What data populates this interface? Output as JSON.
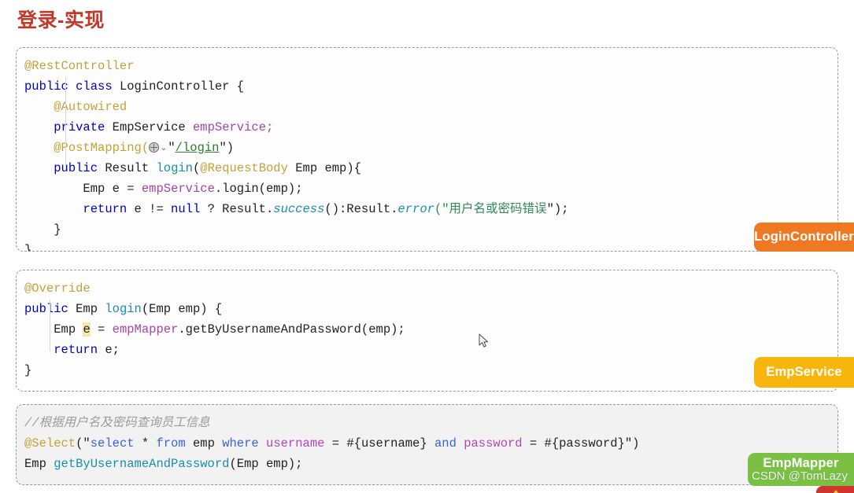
{
  "page": {
    "title": "登录-实现",
    "title_color": "#c0392b"
  },
  "blocks": [
    {
      "id": "login-controller",
      "badge": {
        "label": "LoginController",
        "color": "#ef7923"
      },
      "lines": [
        "@RestController",
        "public class LoginController {",
        "    @Autowired",
        "    private EmpService empService;",
        "    @PostMapping(\"/login\")",
        "    public Result login(@RequestBody Emp emp){",
        "        Emp e = empService.login(emp);",
        "        return e != null ? Result.success():Result.error(\"用户名或密码错误\");",
        "    }",
        "}"
      ]
    },
    {
      "id": "emp-service",
      "badge": {
        "label": "EmpService",
        "color": "#f8b50c"
      },
      "lines": [
        "@Override",
        "public Emp login(Emp emp) {",
        "    Emp e = empMapper.getByUsernameAndPassword(emp);",
        "    return e;",
        "}"
      ]
    },
    {
      "id": "emp-mapper",
      "badge": {
        "label": "EmpMapper",
        "color": "#7ac143"
      },
      "lines": [
        "//根据用户名及密码查询员工信息",
        "@Select(\"select * from emp where username = #{username} and password = #{password}\")",
        "Emp getByUsernameAndPassword(Emp emp);"
      ]
    }
  ],
  "tokens": {
    "t_restcontroller": "@RestController",
    "t_public": "public",
    "t_class": "class",
    "t_LoginController": "LoginController",
    "t_obrace": "{",
    "t_cbrace": "}",
    "t_autowired": "@Autowired",
    "t_private": "private",
    "t_EmpService": "EmpService",
    "t_empService_field": "empService;",
    "t_postmapping": "@PostMapping(",
    "t_quote": "\"",
    "t_login_path": "/login",
    "t_paren_close": ")",
    "t_Result": "Result",
    "t_login": "login",
    "t_paren_open": "(",
    "t_requestbody": "@RequestBody",
    "t_Emp": "Emp",
    "t_emp": "emp",
    "t_close_brace_paren": "){",
    "t_Emp_sp": "Emp ",
    "t_e": "e",
    "t_eq": " = ",
    "t_empService": "empService",
    "t_dot_login_emp": ".login(emp);",
    "t_return": "return",
    "t_neqnull": " e != ",
    "t_null": "null",
    "t_ternary": " ? Result.",
    "t_success": "success",
    "t_success_tail": "():Result.",
    "t_error": "error",
    "t_error_open": "(\"",
    "t_error_msg": "用户名或密码错误",
    "t_error_close": "\");",
    "t_override": "@Override",
    "t_Emp_type": "Emp",
    "t_login2": "login",
    "t_emp_params": "(Emp emp) {",
    "t_empMapper": "empMapper",
    "t_getBy": ".getByUsernameAndPassword(emp);",
    "t_return_e": "e;",
    "t_comment": "//根据用户名及密码查询员工信息",
    "t_select": "@Select",
    "t_select_open": "(\"",
    "t_sql_select": "select",
    "t_sql_star": " * ",
    "t_sql_from": "from",
    "t_sql_emp": " emp ",
    "t_sql_where": "where",
    "t_sql_username": "username",
    "t_sql_eq1": " = #{username} ",
    "t_sql_and": "and",
    "t_sql_password": "password",
    "t_sql_eq2": " = #{password}",
    "t_select_close": "\")",
    "t_Emp_ret": "Emp ",
    "t_getBy_sig": "getByUsernameAndPassword",
    "t_sig_params": "(Emp emp);"
  },
  "watermark": {
    "text": "CSDN @TomLazy"
  },
  "icons": {
    "globe": "globe-icon",
    "chevron": "⌄",
    "cursor": "mouse-pointer"
  }
}
